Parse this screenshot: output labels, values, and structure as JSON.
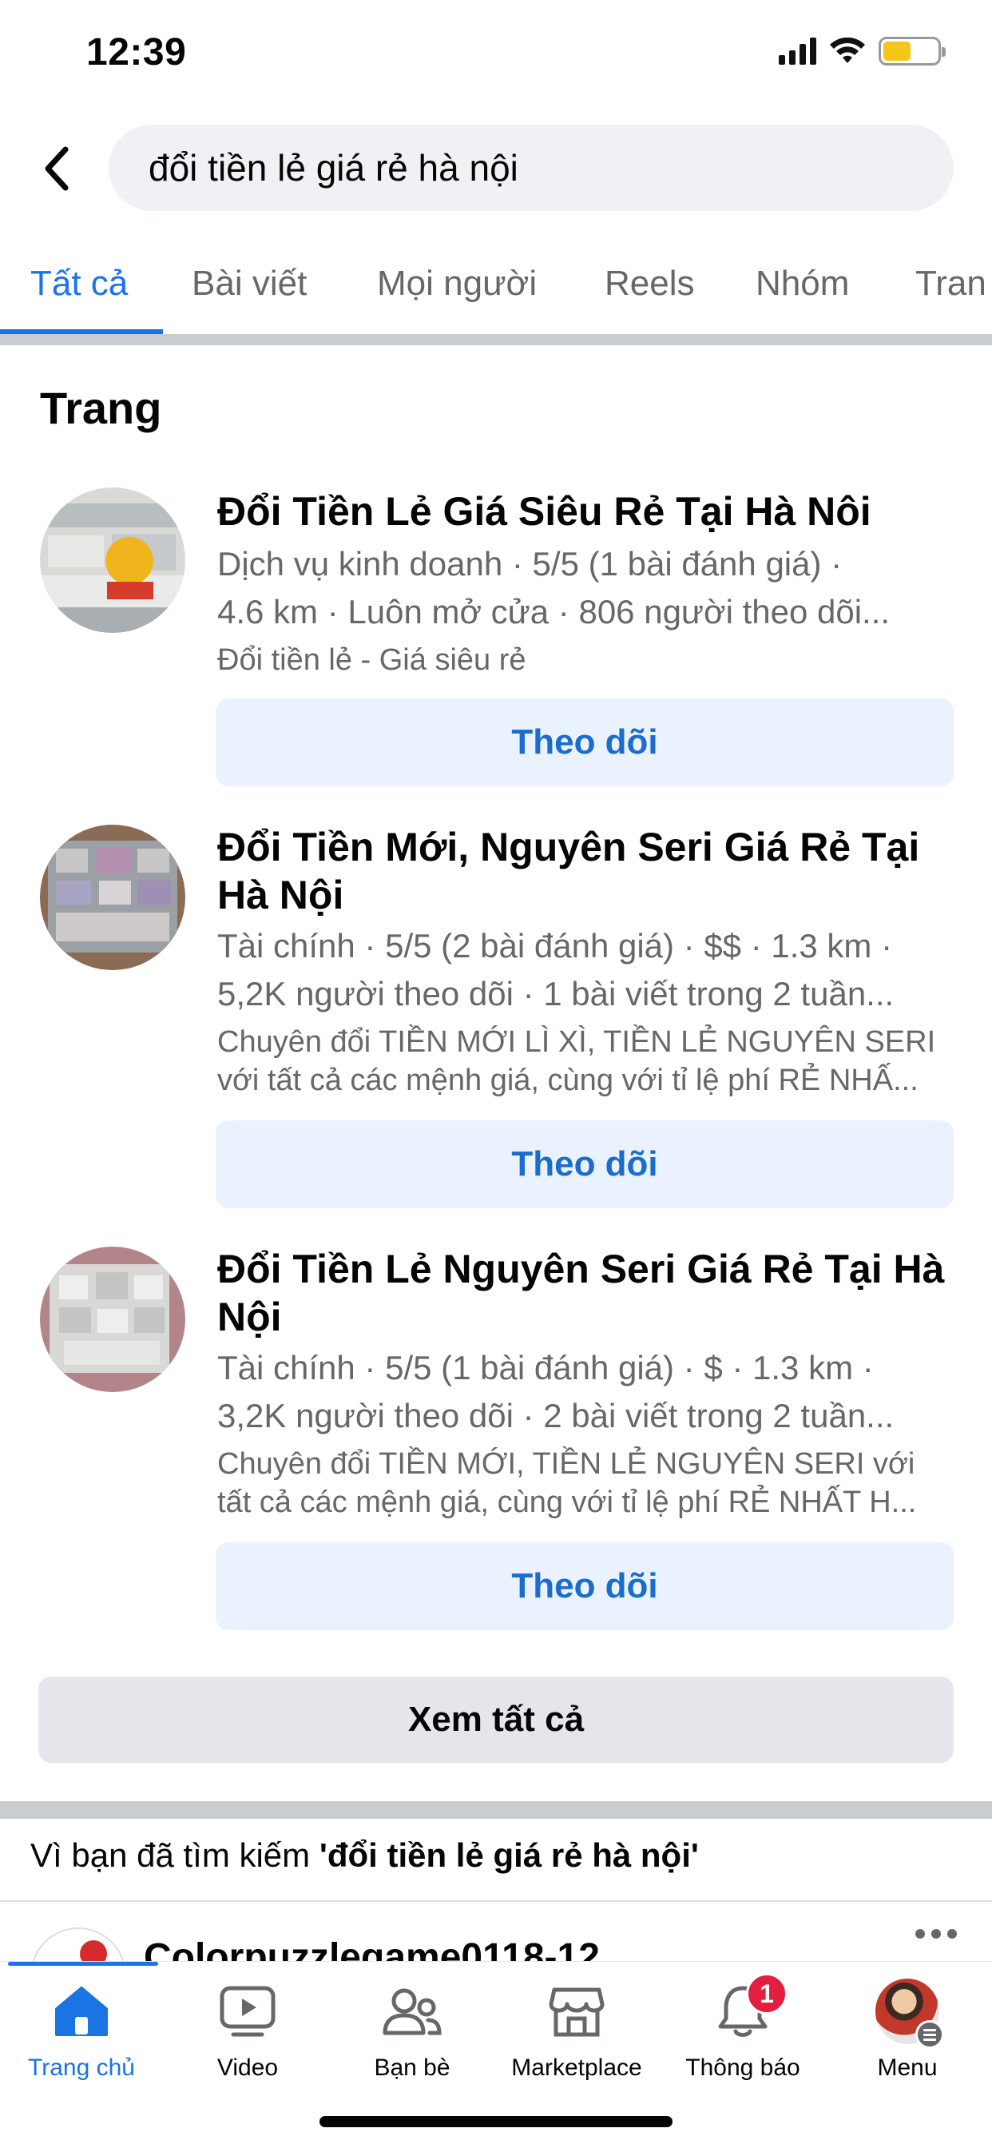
{
  "status_bar": {
    "time": "12:39",
    "icons": [
      "cellular-signal-icon",
      "wifi-icon",
      "battery-icon"
    ],
    "battery_color": "#f5c518"
  },
  "search": {
    "back_icon": "chevron-left-icon",
    "query": "đổi tiền lẻ giá rẻ hà nội"
  },
  "tabs": [
    {
      "label": "Tất cả",
      "active": true
    },
    {
      "label": "Bài viết",
      "active": false
    },
    {
      "label": "Mọi người",
      "active": false
    },
    {
      "label": "Reels",
      "active": false
    },
    {
      "label": "Nhóm",
      "active": false
    },
    {
      "label": "Tran",
      "active": false
    }
  ],
  "colors": {
    "accent": "#1b74e4",
    "follow_bg": "#e9f2fe",
    "secondary_text": "#65676b",
    "notification_badge": "#e41e3f"
  },
  "pages_section": {
    "title": "Trang",
    "items": [
      {
        "title": "Đổi Tiền Lẻ Giá Siêu Rẻ Tại Hà Nôi",
        "meta_line1": "Dịch vụ kinh doanh · 5/5 (1 bài đánh giá) ·",
        "meta_line2": "4.6 km · Luôn mở cửa · 806 người theo dõi...",
        "desc_line1": "Đổi tiền lẻ - Giá siêu rẻ",
        "follow_label": "Theo dõi"
      },
      {
        "title": "Đổi Tiền Mới, Nguyên Seri Giá Rẻ Tại Hà Nội",
        "meta_line1": "Tài chính · 5/5 (2 bài đánh giá) · $$ · 1.3 km ·",
        "meta_line2": "5,2K người theo dõi · 1 bài viết trong 2 tuần...",
        "desc_line1": "Chuyên đổi TIỀN MỚI LÌ XÌ, TIỀN LẺ NGUYÊN SERI",
        "desc_line2": "với tất cả các mệnh giá, cùng với tỉ lệ phí RẺ NHẤ...",
        "follow_label": "Theo dõi"
      },
      {
        "title": "Đổi Tiền Lẻ Nguyên Seri Giá Rẻ Tại Hà Nội",
        "meta_line1": "Tài chính · 5/5 (1 bài đánh giá) · $ · 1.3 km ·",
        "meta_line2": "3,2K người theo dõi · 2 bài viết trong 2 tuần...",
        "desc_line1": "Chuyên đổi TIỀN MỚI, TIỀN LẺ NGUYÊN SERI với",
        "desc_line2": "tất cả các mệnh giá, cùng với tỉ lệ phí RẺ NHẤT H...",
        "follow_label": "Theo dõi"
      }
    ],
    "see_all_label": "Xem tất cả"
  },
  "because_section": {
    "prefix": "Vì bạn đã tìm kiếm ",
    "query": "'đổi tiền lẻ giá rẻ hà nội'",
    "next_post_name": "Colorpuzzlegame0118-12"
  },
  "bottom_nav": [
    {
      "label": "Trang chủ",
      "icon": "home-icon",
      "active": true
    },
    {
      "label": "Video",
      "icon": "video-icon",
      "active": false
    },
    {
      "label": "Bạn bè",
      "icon": "friends-icon",
      "active": false
    },
    {
      "label": "Marketplace",
      "icon": "marketplace-icon",
      "active": false
    },
    {
      "label": "Thông báo",
      "icon": "bell-icon",
      "active": false,
      "badge": "1"
    },
    {
      "label": "Menu",
      "icon": "profile-avatar-icon",
      "active": false
    }
  ]
}
